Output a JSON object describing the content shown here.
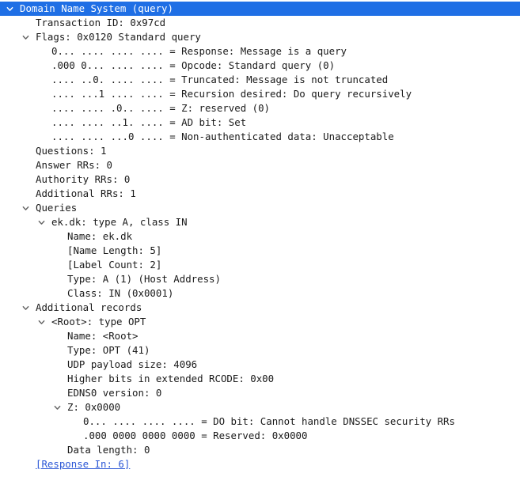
{
  "tree": {
    "rows": [
      {
        "text": "Domain Name System (query)",
        "expandable": true,
        "selected": true
      },
      {
        "text": "Transaction ID: 0x97cd"
      },
      {
        "text": "Flags: 0x0120 Standard query",
        "expandable": true
      },
      {
        "text": "0... .... .... .... = Response: Message is a query"
      },
      {
        "text": ".000 0... .... .... = Opcode: Standard query (0)"
      },
      {
        "text": ".... ..0. .... .... = Truncated: Message is not truncated"
      },
      {
        "text": ".... ...1 .... .... = Recursion desired: Do query recursively"
      },
      {
        "text": ".... .... .0.. .... = Z: reserved (0)"
      },
      {
        "text": ".... .... ..1. .... = AD bit: Set"
      },
      {
        "text": ".... .... ...0 .... = Non-authenticated data: Unacceptable"
      },
      {
        "text": "Questions: 1"
      },
      {
        "text": "Answer RRs: 0"
      },
      {
        "text": "Authority RRs: 0"
      },
      {
        "text": "Additional RRs: 1"
      },
      {
        "text": "Queries",
        "expandable": true
      },
      {
        "text": "ek.dk: type A, class IN",
        "expandable": true
      },
      {
        "text": "Name: ek.dk"
      },
      {
        "text": "[Name Length: 5]"
      },
      {
        "text": "[Label Count: 2]"
      },
      {
        "text": "Type: A (1) (Host Address)"
      },
      {
        "text": "Class: IN (0x0001)"
      },
      {
        "text": "Additional records",
        "expandable": true
      },
      {
        "text": "<Root>: type OPT",
        "expandable": true
      },
      {
        "text": "Name: <Root>"
      },
      {
        "text": "Type: OPT (41)"
      },
      {
        "text": "UDP payload size: 4096"
      },
      {
        "text": "Higher bits in extended RCODE: 0x00"
      },
      {
        "text": "EDNS0 version: 0"
      },
      {
        "text": "Z: 0x0000",
        "expandable": true
      },
      {
        "text": "0... .... .... .... = DO bit: Cannot handle DNSSEC security RRs"
      },
      {
        "text": ".000 0000 0000 0000 = Reserved: 0x0000"
      },
      {
        "text": "Data length: 0"
      },
      {
        "text": "[Response In: 6]",
        "link": true
      }
    ]
  },
  "icons": {
    "expanded_toggle": "chevron-down-icon"
  },
  "colors": {
    "selection": "#1f6fe5",
    "link": "#2b57d6",
    "text": "#1a1a1a",
    "toggle": "#666666"
  }
}
